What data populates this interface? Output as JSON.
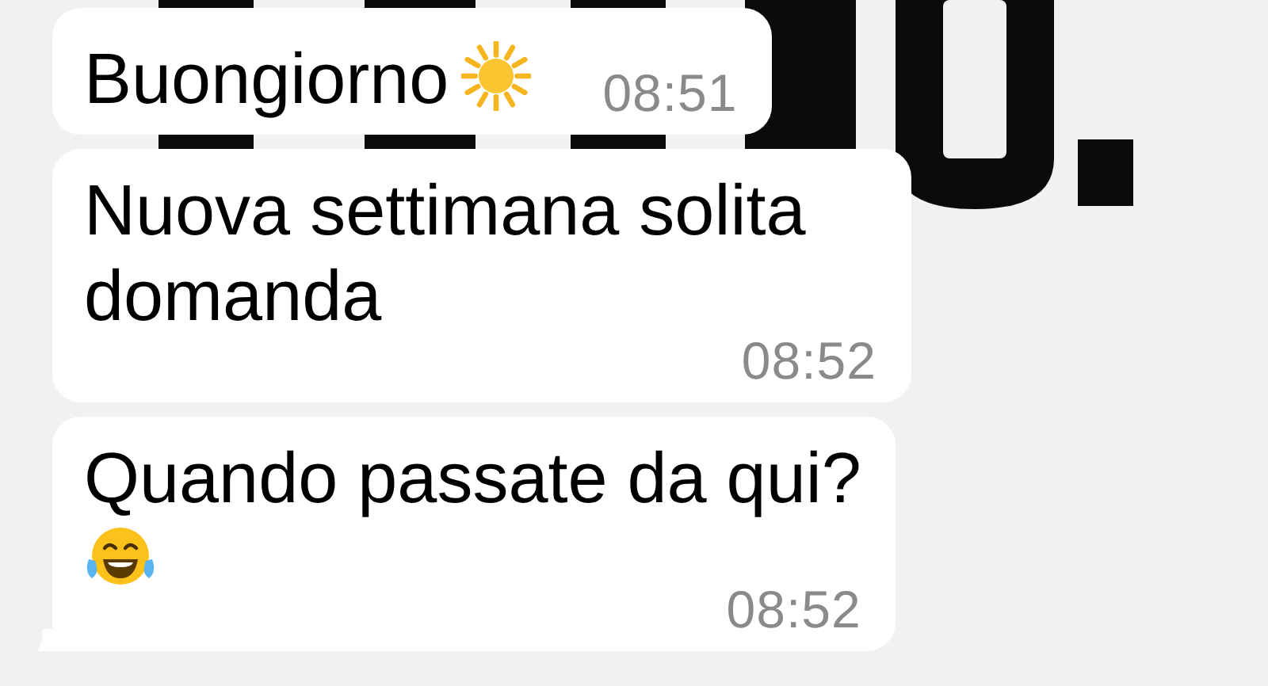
{
  "messages": [
    {
      "kind": "inline-icon",
      "text": "Buongiorno",
      "time": "08:51",
      "tail": false
    },
    {
      "kind": "plain",
      "text": "Nuova settimana solita domanda",
      "time": "08:52",
      "tail": false
    },
    {
      "kind": "icon-line",
      "text": "Quando passate da qui?",
      "time": "08:52",
      "tail": true
    }
  ]
}
